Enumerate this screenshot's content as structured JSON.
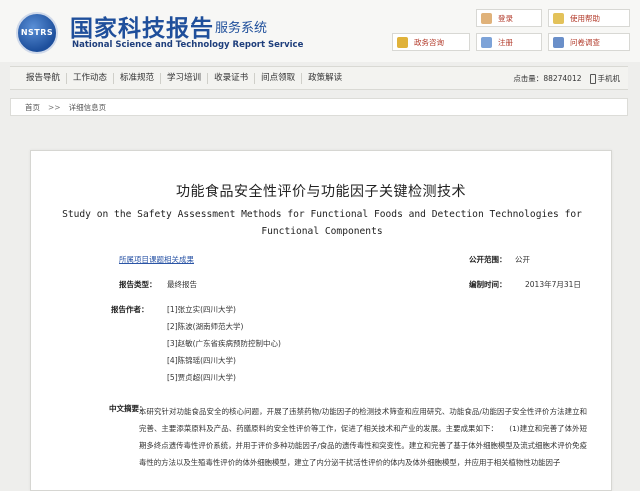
{
  "header": {
    "logo_text": "NSTRS",
    "title_cn": "国家科技报告",
    "subtitle_cn": "服务系统",
    "title_en": "National Science and Technology Report Service",
    "buttons": {
      "login": "登录",
      "help": "使用帮助",
      "consult": "政务咨询",
      "register": "注册",
      "survey": "问卷调查"
    }
  },
  "nav": {
    "items": [
      "报告导航",
      "工作动态",
      "标准规范",
      "学习培训",
      "收录证书",
      "间点领取",
      "政策解读"
    ],
    "hits_label": "点击量：",
    "hits_value": "88274012",
    "mobile_label": "手机机"
  },
  "breadcrumb": {
    "home": "首页",
    "separator": ">>",
    "current": "详细信息页"
  },
  "report": {
    "title_cn": "功能食品安全性评价与功能因子关键检测技术",
    "title_en": "Study on the Safety Assessment Methods for Functional Foods and Detection Technologies for Functional Components",
    "project_link": "所属项目课题相关成果",
    "open_label": "公开范围：",
    "open_value": "公开",
    "type_label": "报告类型：",
    "type_value": "最终报告",
    "date_label": "编制时间：",
    "date_value": "2013年7月31日",
    "authors_label": "报告作者：",
    "authors": [
      "[1]张立实(四川大学)",
      "[2]陈波(湖南师范大学)",
      "[3]赵敏(广东省疾病预防控制中心)",
      "[4]陈锦瑶(四川大学)",
      "[5]贾贞超(四川大学)"
    ],
    "abstract_label": "中文摘要：",
    "abstract": "本研究针对功能食品安全的核心问题，开展了违禁药物/功能因子的检测技术筛查和应用研究、功能食品/功能因子安全性评价方法建立和完善、主要添菜原料及产品、药膳原料的安全性评价等工作，促进了相关技术和产业的发展。主要成果如下：　　(1)建立和完善了体外短期多终点遗传毒性评价系统，并用于评价多种功能因子/食品的遗传毒性和突变性。建立和完善了基于体外细胞模型及流式细胞术评价免疫毒性的方法以及生殖毒性评价的体外细胞模型，建立了内分泌干扰活性评价的体内及体外细胞模型，并应用于相关植物性功能因子"
  }
}
